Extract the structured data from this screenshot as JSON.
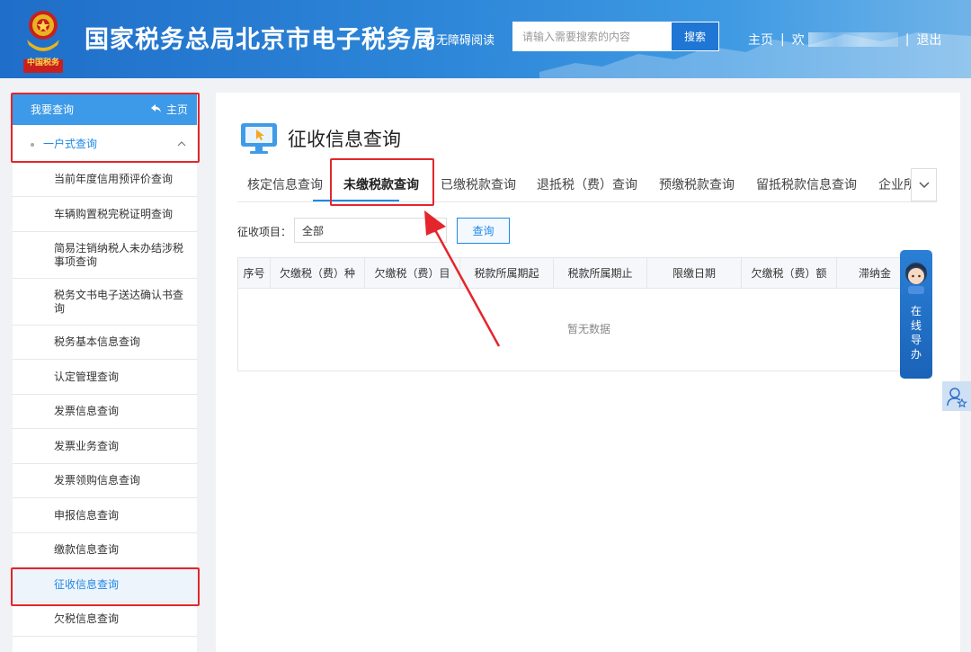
{
  "header": {
    "emblem_text": "中国税务",
    "title": "国家税务总局北京市电子税务局",
    "accessibility_label": "无障碍阅读",
    "search_placeholder": "请输入需要搜索的内容",
    "search_button": "搜索",
    "home_link": "主页",
    "separator": "|",
    "welcome": "欢",
    "logout": "退出"
  },
  "sidebar": {
    "header_label": "我要查询",
    "home_link": "主页",
    "group_label": "一户式查询",
    "items": [
      {
        "label": "当前年度信用预评价查询",
        "active": false
      },
      {
        "label": "车辆购置税完税证明查询",
        "active": false
      },
      {
        "label": "简易注销纳税人未办结涉税事项查询",
        "active": false
      },
      {
        "label": "税务文书电子送达确认书查询",
        "active": false
      },
      {
        "label": "税务基本信息查询",
        "active": false
      },
      {
        "label": "认定管理查询",
        "active": false
      },
      {
        "label": "发票信息查询",
        "active": false
      },
      {
        "label": "发票业务查询",
        "active": false
      },
      {
        "label": "发票领购信息查询",
        "active": false
      },
      {
        "label": "申报信息查询",
        "active": false
      },
      {
        "label": "缴款信息查询",
        "active": false
      },
      {
        "label": "征收信息查询",
        "active": true
      },
      {
        "label": "欠税信息查询",
        "active": false
      }
    ]
  },
  "main": {
    "page_title": "征收信息查询",
    "tabs": [
      {
        "label": "核定信息查询",
        "active": false
      },
      {
        "label": "未缴税款查询",
        "active": true
      },
      {
        "label": "已缴税款查询",
        "active": false
      },
      {
        "label": "退抵税（费）查询",
        "active": false
      },
      {
        "label": "预缴税款查询",
        "active": false
      },
      {
        "label": "留抵税款信息查询",
        "active": false
      },
      {
        "label": "企业所",
        "active": false
      }
    ],
    "filter": {
      "label": "征收项目：",
      "selected": "全部",
      "query_button": "查询"
    },
    "table": {
      "columns": [
        "序号",
        "欠缴税（费）种",
        "欠缴税（费）目",
        "税款所属期起",
        "税款所属期止",
        "限缴日期",
        "欠缴税（费）额",
        "滞纳金"
      ],
      "empty_text": "暂无数据"
    }
  },
  "guide_widget": {
    "chars": [
      "在",
      "线",
      "导",
      "办"
    ]
  },
  "colors": {
    "header_blue": "#2d86d8",
    "accent_blue": "#1e88e5",
    "highlight_red": "#e4252c"
  }
}
